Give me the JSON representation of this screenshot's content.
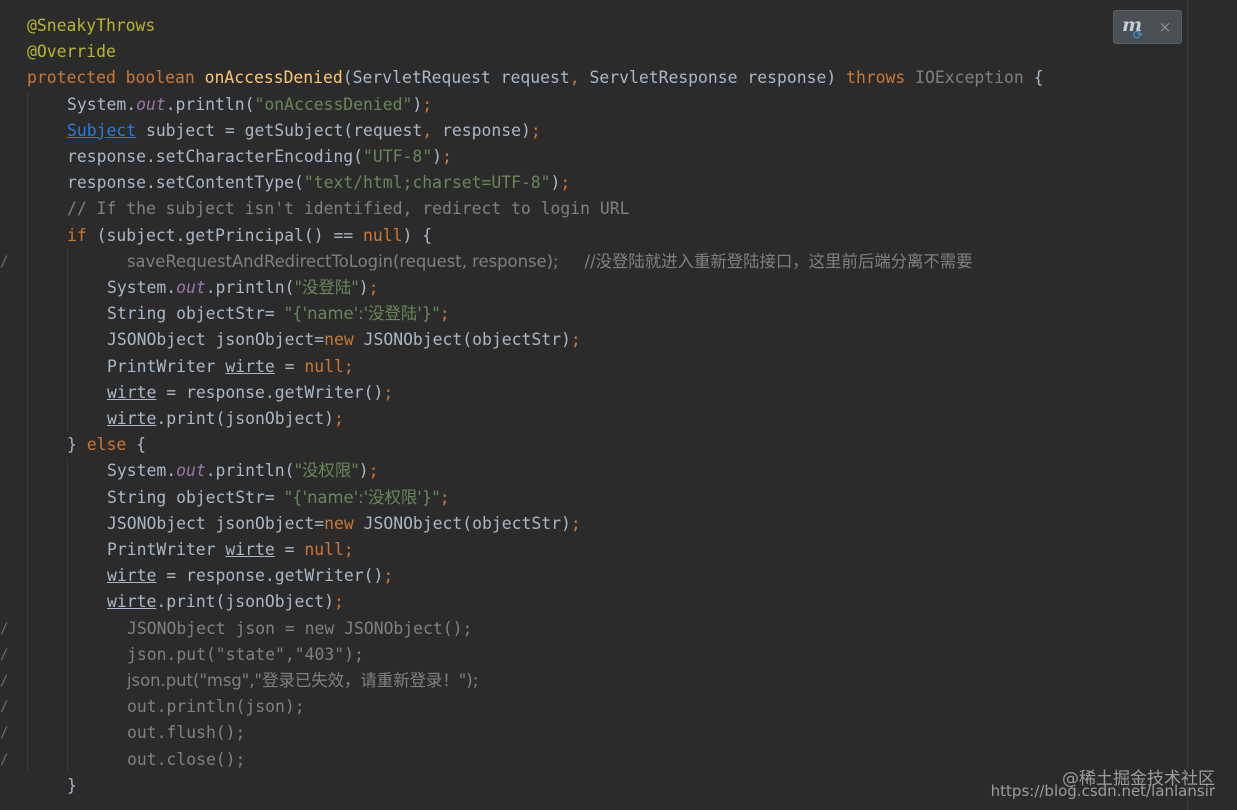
{
  "editor": {
    "language": "java",
    "theme": "darcula",
    "colors": {
      "background": "#2b2b2b",
      "text": "#a9b7c6",
      "keyword": "#cc7832",
      "method": "#ffc66d",
      "string": "#6a8759",
      "annotation": "#bbb529",
      "static_field": "#9876aa",
      "comment": "#808080",
      "link": "#287bde"
    },
    "lines": [
      {
        "indent": 0,
        "gutter": "",
        "tokens": [
          [
            "ann",
            "@SneakyThrows"
          ]
        ]
      },
      {
        "indent": 0,
        "gutter": "",
        "tokens": [
          [
            "ann",
            "@Override"
          ]
        ]
      },
      {
        "indent": 0,
        "gutter": "",
        "tokens": [
          [
            "kw",
            "protected boolean "
          ],
          [
            "fn",
            "onAccessDenied"
          ],
          [
            "",
            "(ServletRequest request"
          ],
          [
            "kw",
            ", "
          ],
          [
            "",
            "ServletResponse response) "
          ],
          [
            "kw",
            "throws "
          ],
          [
            "dim",
            "IOException "
          ],
          [
            "",
            "{"
          ]
        ]
      },
      {
        "indent": 1,
        "gutter": "",
        "tokens": [
          [
            "",
            "System."
          ],
          [
            "it",
            "out"
          ],
          [
            "",
            ".println("
          ],
          [
            "str",
            "\"onAccessDenied\""
          ],
          [
            "",
            ")"
          ],
          [
            "kw",
            ";"
          ]
        ]
      },
      {
        "indent": 1,
        "gutter": "",
        "tokens": [
          [
            "link",
            "Subject"
          ],
          [
            "",
            " subject = getSubject(request"
          ],
          [
            "kw",
            ", "
          ],
          [
            "",
            "response)"
          ],
          [
            "kw",
            ";"
          ]
        ]
      },
      {
        "indent": 1,
        "gutter": "",
        "tokens": [
          [
            "",
            "response.setCharacterEncoding("
          ],
          [
            "str",
            "\"UTF-8\""
          ],
          [
            "",
            ")"
          ],
          [
            "kw",
            ";"
          ]
        ]
      },
      {
        "indent": 1,
        "gutter": "",
        "tokens": [
          [
            "",
            "response.setContentType("
          ],
          [
            "str",
            "\"text/html;charset=UTF-8\""
          ],
          [
            "",
            ")"
          ],
          [
            "kw",
            ";"
          ]
        ]
      },
      {
        "indent": 1,
        "gutter": "",
        "tokens": [
          [
            "cmt",
            "// If the subject isn't identified, redirect to login URL"
          ]
        ]
      },
      {
        "indent": 1,
        "gutter": "",
        "tokens": [
          [
            "kw",
            "if "
          ],
          [
            "",
            "(subject.getPrincipal() == "
          ],
          [
            "kw",
            "null"
          ],
          [
            "",
            ") {"
          ]
        ]
      },
      {
        "indent": 2.5,
        "gutter": "/",
        "tokens": [
          [
            "dim",
            "saveRequestAndRedirectToLogin(request, response);     //没登陆就进入重新登陆接口，这里前后端分离不需要"
          ]
        ]
      },
      {
        "indent": 2,
        "gutter": "",
        "tokens": [
          [
            "",
            "System."
          ],
          [
            "it",
            "out"
          ],
          [
            "",
            ".println("
          ],
          [
            "str",
            "\"没登陆\""
          ],
          [
            "",
            ")"
          ],
          [
            "kw",
            ";"
          ]
        ]
      },
      {
        "indent": 2,
        "gutter": "",
        "tokens": [
          [
            "",
            "String objectStr= "
          ],
          [
            "str",
            "\"{'name':'没登陆'}\""
          ],
          [
            "kw",
            ";"
          ]
        ]
      },
      {
        "indent": 2,
        "gutter": "",
        "tokens": [
          [
            "",
            "JSONObject jsonObject="
          ],
          [
            "kw",
            "new "
          ],
          [
            "",
            "JSONObject(objectStr)"
          ],
          [
            "kw",
            ";"
          ]
        ]
      },
      {
        "indent": 2,
        "gutter": "",
        "tokens": [
          [
            "",
            "PrintWriter "
          ],
          [
            "ul",
            "wirte"
          ],
          [
            "",
            " = "
          ],
          [
            "kw",
            "null;"
          ]
        ]
      },
      {
        "indent": 2,
        "gutter": "",
        "tokens": [
          [
            "ul",
            "wirte"
          ],
          [
            "",
            " = response.getWriter()"
          ],
          [
            "kw",
            ";"
          ]
        ]
      },
      {
        "indent": 2,
        "gutter": "",
        "tokens": [
          [
            "ul",
            "wirte"
          ],
          [
            "",
            ".print(jsonObject)"
          ],
          [
            "kw",
            ";"
          ]
        ]
      },
      {
        "indent": 1,
        "gutter": "",
        "tokens": [
          [
            "",
            "} "
          ],
          [
            "kw",
            "else "
          ],
          [
            "",
            "{"
          ]
        ]
      },
      {
        "indent": 2,
        "gutter": "",
        "tokens": [
          [
            "",
            "System."
          ],
          [
            "it",
            "out"
          ],
          [
            "",
            ".println("
          ],
          [
            "str",
            "\"没权限\""
          ],
          [
            "",
            ")"
          ],
          [
            "kw",
            ";"
          ]
        ]
      },
      {
        "indent": 2,
        "gutter": "",
        "tokens": [
          [
            "",
            "String objectStr= "
          ],
          [
            "str",
            "\"{'name':'没权限'}\""
          ],
          [
            "kw",
            ";"
          ]
        ]
      },
      {
        "indent": 2,
        "gutter": "",
        "tokens": [
          [
            "",
            "JSONObject jsonObject="
          ],
          [
            "kw",
            "new "
          ],
          [
            "",
            "JSONObject(objectStr)"
          ],
          [
            "kw",
            ";"
          ]
        ]
      },
      {
        "indent": 2,
        "gutter": "",
        "tokens": [
          [
            "",
            "PrintWriter "
          ],
          [
            "ul",
            "wirte"
          ],
          [
            "",
            " = "
          ],
          [
            "kw",
            "null;"
          ]
        ]
      },
      {
        "indent": 2,
        "gutter": "",
        "tokens": [
          [
            "ul",
            "wirte"
          ],
          [
            "",
            " = response.getWriter()"
          ],
          [
            "kw",
            ";"
          ]
        ]
      },
      {
        "indent": 2,
        "gutter": "",
        "tokens": [
          [
            "ul",
            "wirte"
          ],
          [
            "",
            ".print(jsonObject)"
          ],
          [
            "kw",
            ";"
          ]
        ]
      },
      {
        "indent": 2.5,
        "gutter": "/",
        "tokens": [
          [
            "dim",
            "JSONObject json = new JSONObject();"
          ]
        ]
      },
      {
        "indent": 2.5,
        "gutter": "/",
        "tokens": [
          [
            "dim",
            "json.put(\"state\",\"403\");"
          ]
        ]
      },
      {
        "indent": 2.5,
        "gutter": "/",
        "tokens": [
          [
            "dim",
            "json.put(\"msg\",\"登录已失效，请重新登录！\");"
          ]
        ]
      },
      {
        "indent": 2.5,
        "gutter": "/",
        "tokens": [
          [
            "dim",
            "out.println(json);"
          ]
        ]
      },
      {
        "indent": 2.5,
        "gutter": "/",
        "tokens": [
          [
            "dim",
            "out.flush();"
          ]
        ]
      },
      {
        "indent": 2.5,
        "gutter": "/",
        "tokens": [
          [
            "dim",
            "out.close();"
          ]
        ]
      },
      {
        "indent": 1,
        "gutter": "",
        "tokens": [
          [
            "",
            "}"
          ]
        ]
      }
    ]
  },
  "plugin_popup": {
    "icon": "maven-sync-icon",
    "logo_letter": "m",
    "sync_glyph": "⟳",
    "close_glyph": "×"
  },
  "watermark": {
    "line1": "@稀土掘金技术社区",
    "line2": "https://blog.csdn.net/lanlansir"
  }
}
